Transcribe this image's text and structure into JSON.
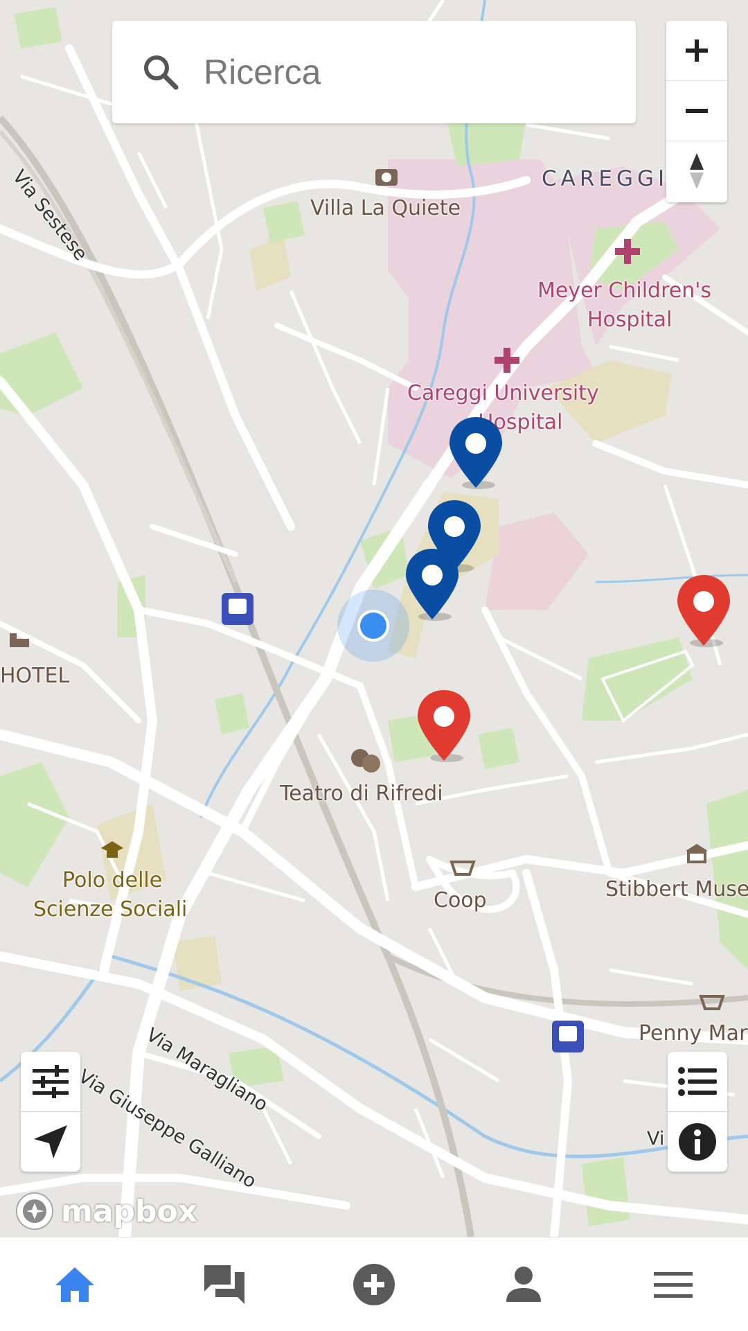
{
  "search": {
    "placeholder": "Ricerca"
  },
  "map": {
    "district": "CAREGGI",
    "pois": {
      "villa": "Villa La Quiete",
      "meyer_line1": "Meyer Children's",
      "meyer_line2": "Hospital",
      "careggi_line1": "Careggi University",
      "careggi_line2": "Hospital",
      "hotel": "HOTEL",
      "teatro": "Teatro di Rifredi",
      "polo_line1": "Polo delle",
      "polo_line2": "Scienze Sociali",
      "coop": "Coop",
      "stibbert": "Stibbert Muse",
      "penny": "Penny Mar"
    },
    "streets": {
      "sestese": "Via Sestese",
      "maragliano": "Via Maragliano",
      "galliano": "Via Giuseppe Galliano",
      "vi_partial": "Vi"
    },
    "attribution": "mapbox"
  },
  "colors": {
    "blue_pin": "#0a4ea3",
    "red_pin": "#e13a2e",
    "user_location": "#3a8ef0",
    "nav_active": "#3a84f0",
    "nav_inactive": "#5a5a5a"
  },
  "icons": {
    "search": "search-icon",
    "zoom_in": "plus-icon",
    "zoom_out": "minus-icon",
    "compass": "compass-icon",
    "filter": "sliders-icon",
    "locate": "navigation-arrow-icon",
    "list": "list-icon",
    "info": "info-icon"
  },
  "bottom_nav": [
    {
      "name": "home",
      "active": true
    },
    {
      "name": "messages",
      "active": false
    },
    {
      "name": "add",
      "active": false
    },
    {
      "name": "profile",
      "active": false
    },
    {
      "name": "menu",
      "active": false
    }
  ]
}
